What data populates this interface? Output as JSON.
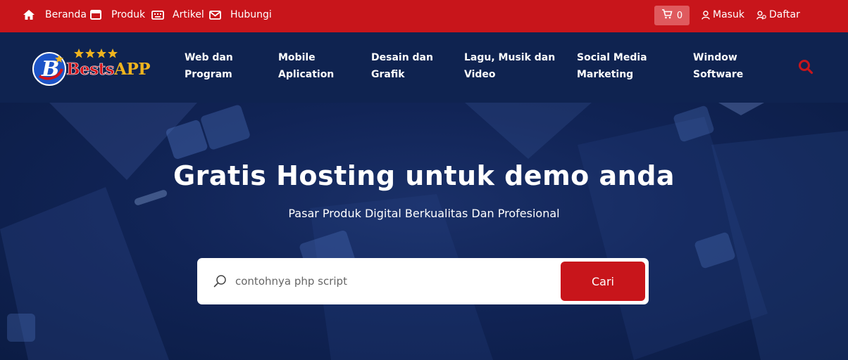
{
  "topbar": {
    "links": [
      {
        "label": "Beranda",
        "icon": "home-icon"
      },
      {
        "label": "Produk",
        "icon": "window-icon"
      },
      {
        "label": "Artikel",
        "icon": "keyboard-icon"
      },
      {
        "label": "Hubungi",
        "icon": "envelope-icon"
      }
    ],
    "cart_count": "0",
    "login_label": "Masuk",
    "register_label": "Daftar"
  },
  "logo": {
    "part1": "Bests",
    "part2": "APP"
  },
  "nav": {
    "items": [
      {
        "line1": "Web dan",
        "line2": "Program"
      },
      {
        "line1": "Mobile",
        "line2": "Aplication"
      },
      {
        "line1": "Desain dan",
        "line2": "Grafik"
      },
      {
        "line1": "Lagu, Musik dan",
        "line2": "Video"
      },
      {
        "line1": "Social Media",
        "line2": "Marketing"
      },
      {
        "line1": "Window",
        "line2": "Software"
      }
    ]
  },
  "hero": {
    "title": "Gratis Hosting untuk demo anda",
    "subtitle": "Pasar Produk Digital Berkualitas Dan Profesional",
    "search_placeholder": "contohnya php script",
    "search_button": "Cari"
  },
  "colors": {
    "primary_red": "#c8151b",
    "nav_bg": "#0f2350",
    "logo_gold": "#f0b41e"
  }
}
